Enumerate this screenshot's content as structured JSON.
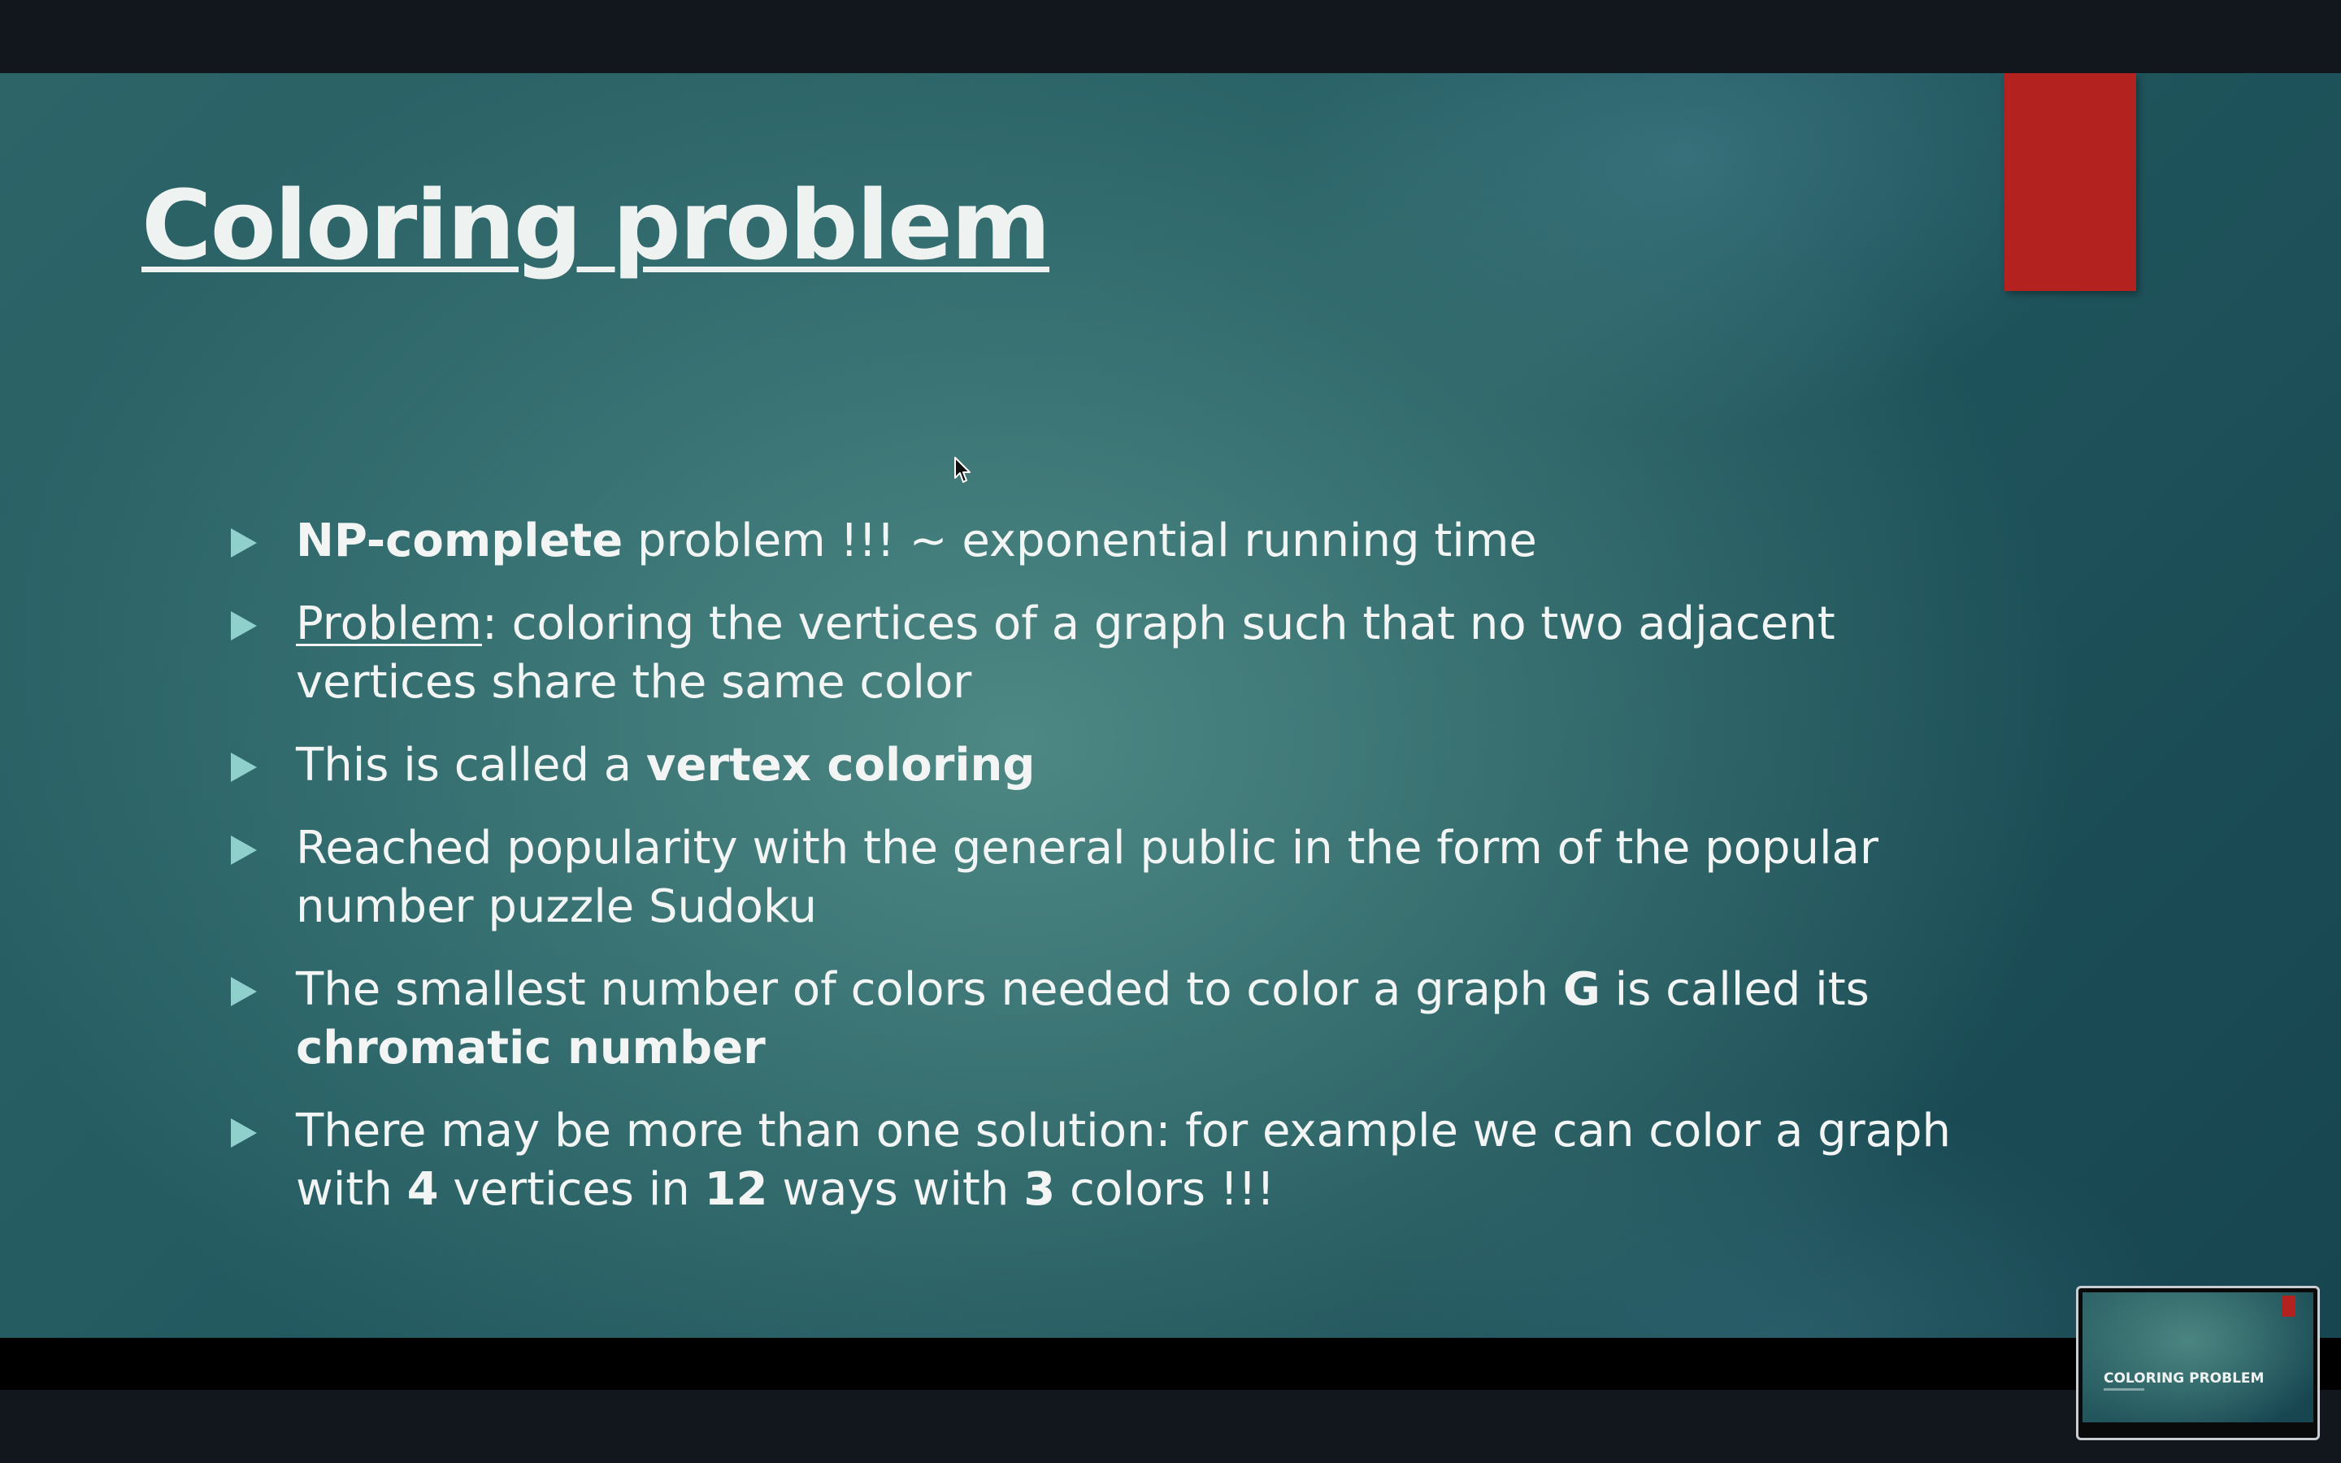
{
  "slide": {
    "title": "Coloring problem",
    "bullets": [
      [
        {
          "text": "NP-complete",
          "style": "bold"
        },
        {
          "text": " problem !!! ~ exponential running time",
          "style": "normal"
        }
      ],
      [
        {
          "text": "Problem",
          "style": "underline"
        },
        {
          "text": ":  coloring the vertices of a graph such that no two adjacent vertices share the same color",
          "style": "normal"
        }
      ],
      [
        {
          "text": "This is called a ",
          "style": "normal"
        },
        {
          "text": "vertex coloring",
          "style": "bold"
        }
      ],
      [
        {
          "text": "Reached popularity with the general public in the form of the popular number puzzle Sudoku",
          "style": "normal"
        }
      ],
      [
        {
          "text": "The smallest number of colors needed to color a graph ",
          "style": "normal"
        },
        {
          "text": "G",
          "style": "bold"
        },
        {
          "text": " is called its ",
          "style": "normal"
        },
        {
          "text": "chromatic number",
          "style": "bold"
        }
      ],
      [
        {
          "text": "There may be more than one solution: for example we can color a graph with ",
          "style": "normal"
        },
        {
          "text": "4",
          "style": "bold"
        },
        {
          "text": " vertices in ",
          "style": "normal"
        },
        {
          "text": "12",
          "style": "bold"
        },
        {
          "text": " ways with ",
          "style": "normal"
        },
        {
          "text": "3",
          "style": "bold"
        },
        {
          "text": " colors !!!",
          "style": "normal"
        }
      ]
    ]
  },
  "thumbnail": {
    "title": "COLORING PROBLEM"
  },
  "icons": {
    "bullet": "triangle-bullet-icon",
    "cursor": "mouse-pointer-icon"
  },
  "colors": {
    "accent_red": "#b3221e",
    "bullet_teal": "#8fd0cd",
    "background_teal": "#245c62",
    "text": "#f2f5f4"
  }
}
